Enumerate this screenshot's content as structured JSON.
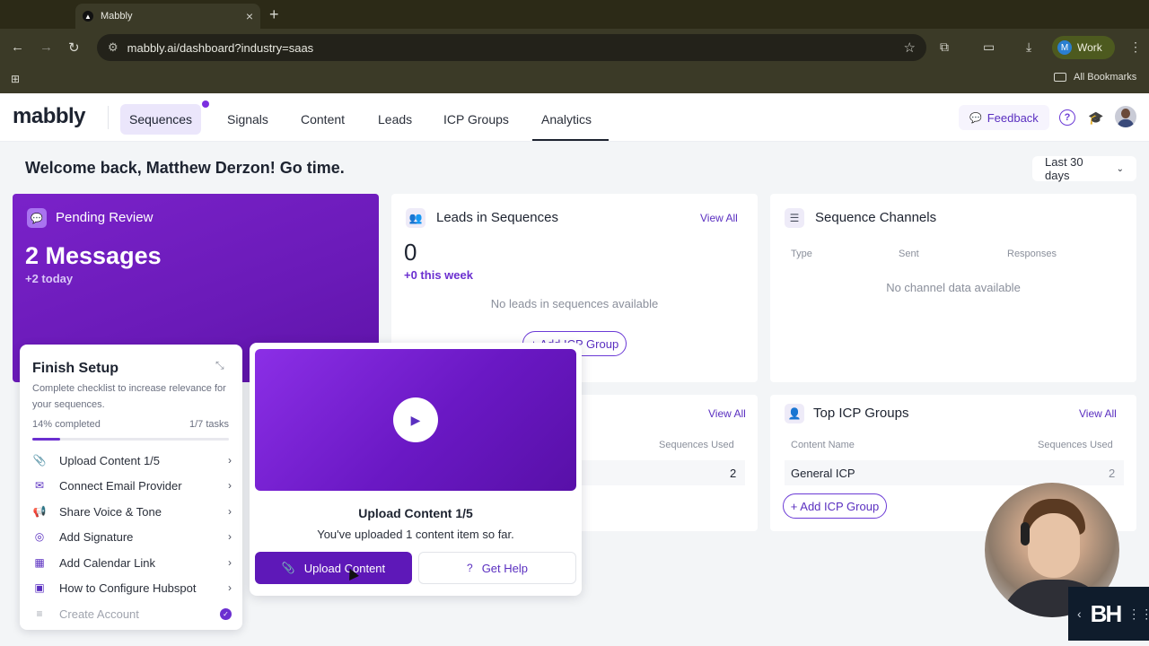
{
  "browser": {
    "tab_title": "Mabbly",
    "url": "mabbly.ai/dashboard?industry=saas",
    "profile_label": "Work",
    "profile_initial": "M",
    "bookmarks_label": "All Bookmarks"
  },
  "app": {
    "logo": "mabbly",
    "nav": [
      {
        "label": "Sequences"
      },
      {
        "label": "Signals"
      },
      {
        "label": "Content"
      },
      {
        "label": "Leads"
      },
      {
        "label": "ICP Groups"
      },
      {
        "label": "Analytics"
      }
    ],
    "feedback_label": "Feedback",
    "accent": "#6b2fd0"
  },
  "dashboard": {
    "welcome": "Welcome back, Matthew Derzon! Go time.",
    "date_range": "Last 30 days",
    "pending": {
      "title": "Pending Review",
      "count": "2 Messages",
      "sub": "+2 today"
    },
    "leads": {
      "title": "Leads in Sequences",
      "view_all": "View All",
      "count": "0",
      "week": "+0 this week",
      "empty": "No leads in sequences available",
      "add_btn": "+ Add ICP Group"
    },
    "channels": {
      "title": "Sequence Channels",
      "cols": [
        "Type",
        "Sent",
        "Responses"
      ],
      "empty": "No channel data available"
    },
    "content_card": {
      "view_all": "View All",
      "col": "Sequences Used",
      "value": "2"
    },
    "icp": {
      "title": "Top ICP Groups",
      "view_all": "View All",
      "col1": "Content Name",
      "col2": "Sequences Used",
      "row_name": "General ICP",
      "row_value": "2",
      "add_btn": "+ Add ICP Group"
    }
  },
  "setup": {
    "title": "Finish Setup",
    "desc": "Complete checklist to increase relevance for your sequences.",
    "percent_label": "14% completed",
    "tasks_label": "1/7 tasks",
    "progress": 0.14,
    "items": [
      {
        "label": "Upload Content 1/5",
        "icon": "paperclip-icon"
      },
      {
        "label": "Connect Email Provider",
        "icon": "mail-icon"
      },
      {
        "label": "Share Voice & Tone",
        "icon": "megaphone-icon"
      },
      {
        "label": "Add Signature",
        "icon": "fingerprint-icon"
      },
      {
        "label": "Add Calendar Link",
        "icon": "calendar-icon"
      },
      {
        "label": "How to Configure Hubspot",
        "icon": "layout-icon"
      },
      {
        "label": "Create Account",
        "icon": "list-icon"
      }
    ]
  },
  "popover": {
    "title": "Upload Content 1/5",
    "desc": "You've uploaded 1 content item so far.",
    "primary": "Upload Content",
    "secondary": "Get Help"
  }
}
